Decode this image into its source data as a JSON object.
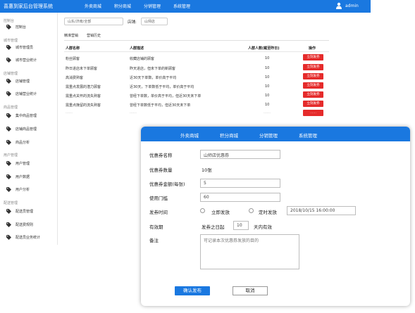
{
  "app": {
    "title": "喜惠到家后台管理系统",
    "user": "admin"
  },
  "top_nav": [
    "外卖商城",
    "积分商城",
    "分销管理",
    "系统管理"
  ],
  "sidebar": {
    "groups": [
      {
        "label": "控制台",
        "items": [
          "控制台"
        ]
      },
      {
        "label": "城市管理",
        "items": [
          "城市管理员",
          "城市营业统计"
        ]
      },
      {
        "label": "店铺管理",
        "items": [
          "店铺管理",
          "店铺营业统计"
        ]
      },
      {
        "label": "商品管理",
        "items": [
          "集中商品管理",
          "店铺商品管理",
          "商品分析"
        ]
      },
      {
        "label": "用户管理",
        "items": [
          "用户管理",
          "用户数据",
          "用户分析"
        ]
      },
      {
        "label": "配送管理",
        "items": [
          "配送员管理",
          "配送费规则",
          "配送员业务统计"
        ]
      }
    ]
  },
  "filters": {
    "region": "山东/济南/全部",
    "store_label": "店铺:",
    "store": "山师店"
  },
  "tabs": [
    "精准营销",
    "营销历史"
  ],
  "table": {
    "headers": [
      "人群名称",
      "人群描述",
      "人群人数(截至昨日)",
      "操作"
    ],
    "rows": [
      {
        "name": "粉丝顾客",
        "desc": "收藏店铺的顾客",
        "count": "10",
        "action": "立刻发券"
      },
      {
        "name": "昨日进店未下单顾客",
        "desc": "昨天进店，但未下单的新顾客",
        "count": "10",
        "action": "立刻发券"
      },
      {
        "name": "高消费熟客",
        "desc": "近30天下单数，单价高于平均",
        "count": "10",
        "action": "立刻发券"
      },
      {
        "name": "需重点发展的潜力顾客",
        "desc": "近30天，下单数低于平均，单价高于平均",
        "count": "10",
        "action": "立刻发券"
      },
      {
        "name": "需重点关怀的流失熟客",
        "desc": "曾经下单数，单价高于平均，但近30天未下单",
        "count": "10",
        "action": "立刻发券"
      },
      {
        "name": "需重点挽留的流失熟客",
        "desc": "曾经下单数低于平均，但近30天未下单",
        "count": "10",
        "action": "立刻发券"
      },
      {
        "name": "……",
        "desc": "……",
        "count": "……",
        "action": "……"
      }
    ]
  },
  "modal": {
    "nav": [
      "外卖商城",
      "积分商城",
      "分销管理",
      "系统管理"
    ],
    "coupon_name_label": "优惠券名称",
    "coupon_name_value": "山师店优惠券",
    "coupon_count_label": "优惠券数量",
    "coupon_count_value": "10张",
    "coupon_amount_label": "优惠券金额(每张)",
    "coupon_amount_value": "5",
    "threshold_label": "使用门槛",
    "threshold_value": "60",
    "send_time_label": "发券时间",
    "send_now_label": "立即发放",
    "send_scheduled_label": "定时发放",
    "scheduled_value": "2018/10/15 16:00:00",
    "validity_label": "有效期",
    "validity_prefix": "发券之日起",
    "validity_days": "10",
    "validity_suffix": "天内有效",
    "remark_label": "备注",
    "remark_placeholder": "可记录本次优惠券发放的目的",
    "confirm_button": "确认发布",
    "cancel_button": "取消"
  },
  "colors": {
    "primary": "#1a78e0",
    "danger": "#e52b2b"
  }
}
